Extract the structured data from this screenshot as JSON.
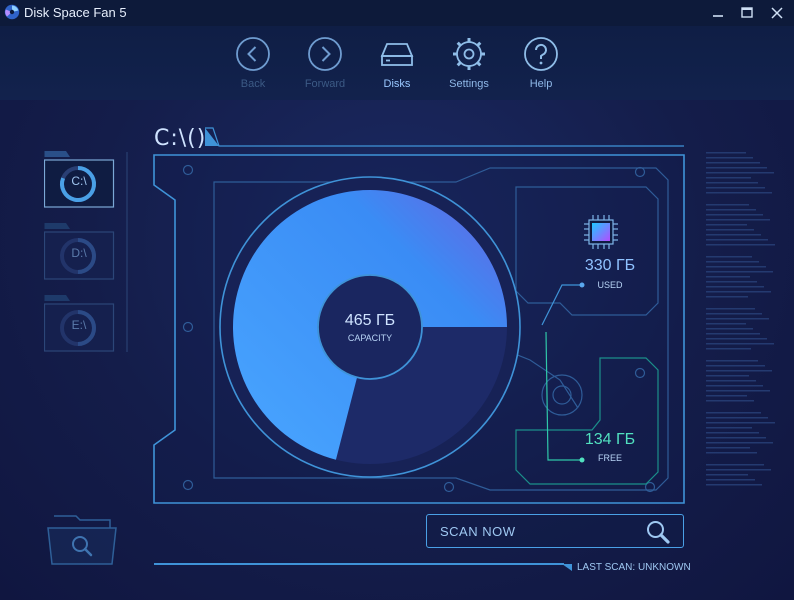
{
  "window": {
    "title": "Disk Space Fan 5",
    "icons": {
      "logo": "fan-logo-icon",
      "minimize": "minimize-icon",
      "maximize": "maximize-icon",
      "close": "close-icon"
    }
  },
  "toolbar": {
    "back_label": "Back",
    "forward_label": "Forward",
    "disks_label": "Disks",
    "settings_label": "Settings",
    "help_label": "Help"
  },
  "drives": [
    {
      "label": "C:\\",
      "selected": true,
      "usage_fraction": 0.71
    },
    {
      "label": "D:\\",
      "selected": false,
      "usage_fraction": 0.5
    },
    {
      "label": "E:\\",
      "selected": false,
      "usage_fraction": 0.5
    }
  ],
  "main": {
    "path_title": "C:\\()",
    "capacity": {
      "value": "465 ГБ",
      "label": "CAPACITY"
    },
    "used": {
      "value": "330 ГБ",
      "label": "USED",
      "fraction": 0.71
    },
    "free": {
      "value": "134 ГБ",
      "label": "FREE",
      "fraction": 0.29
    }
  },
  "scan": {
    "button_label": "SCAN NOW",
    "last_scan": "LAST SCAN: UNKNOWN"
  },
  "colors": {
    "accent": "#4aa0e6",
    "used": "#3a8cf5",
    "used_light": "#49a6ff",
    "free": "#1d2a68",
    "free_text": "#51e0bf",
    "outline": "#3f93d8"
  }
}
